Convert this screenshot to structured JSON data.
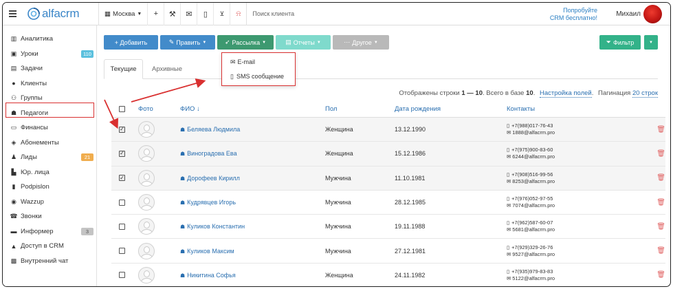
{
  "topbar": {
    "logo": "alfacrm",
    "branch": "Москва",
    "search_placeholder": "Поиск клиента",
    "promo_line1": "Попробуйте",
    "promo_line2": "CRM бесплатно!",
    "user_name": "Михаил"
  },
  "sidebar": {
    "items": [
      {
        "label": "Аналитика",
        "icon": "chart-icon"
      },
      {
        "label": "Уроки",
        "icon": "calendar-icon",
        "badge": "110",
        "badge_color": "#5bc0de"
      },
      {
        "label": "Задачи",
        "icon": "tasks-icon"
      },
      {
        "label": "Клиенты",
        "icon": "user-icon"
      },
      {
        "label": "Группы",
        "icon": "users-icon"
      },
      {
        "label": "Педагоги",
        "icon": "graduation-cap-icon"
      },
      {
        "label": "Финансы",
        "icon": "money-icon"
      },
      {
        "label": "Абонементы",
        "icon": "subscriptions-icon"
      },
      {
        "label": "Лиды",
        "icon": "lead-user-icon",
        "badge": "21",
        "badge_color": "#f0ad4e"
      },
      {
        "label": "Юр. лица",
        "icon": "building-icon"
      },
      {
        "label": "Podpislon",
        "icon": "document-icon"
      },
      {
        "label": "Wazzup",
        "icon": "whatsapp-icon"
      },
      {
        "label": "Звонки",
        "icon": "phone-icon"
      },
      {
        "label": "Информер",
        "icon": "informer-icon",
        "badge": "3",
        "badge_color": "#c4c4c4"
      },
      {
        "label": "Доступ в CRM",
        "icon": "lock-icon"
      },
      {
        "label": "Внутренний чат",
        "icon": "chat-icon"
      }
    ]
  },
  "toolbar": {
    "add": "+ Добавить",
    "edit": "Править",
    "mailing": "Рассылка",
    "reports": "Отчеты",
    "other": "Другое",
    "filter": "Фильтр"
  },
  "mailing_menu": {
    "email": "E-mail",
    "sms": "SMS сообщение"
  },
  "tabs": {
    "current": "Текущие",
    "archive": "Архивные"
  },
  "info": {
    "prefix": "Отображены строки ",
    "range": "1 — 10",
    "total_prefix": ". Всего в базе ",
    "total": "10",
    "settings": "Настройка полей",
    "pagination_label": "Пагинация",
    "pagination_value": "20 строк"
  },
  "table": {
    "headers": {
      "photo": "Фото",
      "fio": "ФИО ↓",
      "gender": "Пол",
      "dob": "Дата рождения",
      "contacts": "Контакты"
    },
    "rows": [
      {
        "checked": true,
        "name": "Беляева Людмила",
        "gender": "Женщина",
        "dob": "13.12.1990",
        "phone": "+7(988)017-76-43",
        "email": "1888@alfacrm.pro"
      },
      {
        "checked": true,
        "name": "Виноградова Ева",
        "gender": "Женщина",
        "dob": "15.12.1986",
        "phone": "+7(975)900-83-60",
        "email": "6244@alfacrm.pro"
      },
      {
        "checked": true,
        "name": "Дорофеев Кирилл",
        "gender": "Мужчина",
        "dob": "11.10.1981",
        "phone": "+7(908)516-99-56",
        "email": "8253@alfacrm.pro"
      },
      {
        "checked": false,
        "name": "Кудрявцев Игорь",
        "gender": "Мужчина",
        "dob": "28.12.1985",
        "phone": "+7(976)052-97-55",
        "email": "7074@alfacrm.pro"
      },
      {
        "checked": false,
        "name": "Куликов Константин",
        "gender": "Мужчина",
        "dob": "19.11.1988",
        "phone": "+7(962)587-60-07",
        "email": "5681@alfacrm.pro"
      },
      {
        "checked": false,
        "name": "Куликов Максим",
        "gender": "Мужчина",
        "dob": "27.12.1981",
        "phone": "+7(929)329-26-76",
        "email": "9527@alfacrm.pro"
      },
      {
        "checked": false,
        "name": "Никитина Софья",
        "gender": "Женщина",
        "dob": "24.11.1982",
        "phone": "+7(935)979-83-83",
        "email": "5122@alfacrm.pro"
      }
    ]
  },
  "colors": {
    "accent_blue": "#428bca",
    "mailing_green": "#3d9970",
    "filter_green": "#33b289",
    "highlight_red": "#d93030"
  }
}
